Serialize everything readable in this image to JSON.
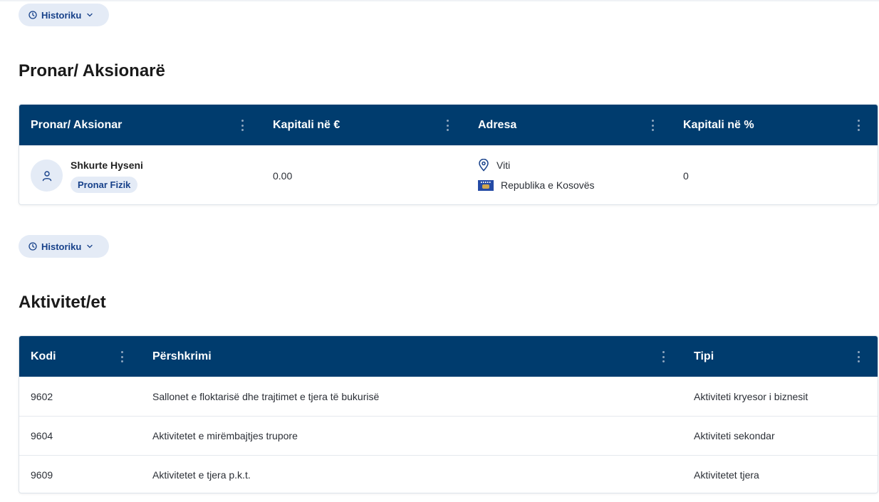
{
  "history_button": {
    "label": "Historiku"
  },
  "owners": {
    "title": "Pronar/ Aksionarë",
    "columns": [
      "Pronar/ Aksionar",
      "Kapitali në €",
      "Adresa",
      "Kapitali në %"
    ],
    "rows": [
      {
        "name": "Shkurte Hyseni",
        "type": "Pronar Fizik",
        "capital_eur": "0.00",
        "city": "Viti",
        "country": "Republika e Kosovës",
        "capital_pct": "0"
      }
    ]
  },
  "activities": {
    "title": "Aktivitet/et",
    "columns": [
      "Kodi",
      "Përshkrimi",
      "Tipi"
    ],
    "rows": [
      {
        "code": "9602",
        "description": "Sallonet e floktarisë dhe trajtimet e tjera të bukurisë",
        "type": "Aktiviteti kryesor i biznesit"
      },
      {
        "code": "9604",
        "description": "Aktivitetet e mirëmbajtjes trupore",
        "type": "Aktiviteti sekondar"
      },
      {
        "code": "9609",
        "description": "Aktivitetet e tjera p.k.t.",
        "type": "Aktivitetet tjera"
      }
    ]
  },
  "colors": {
    "header_bg": "#003c6e",
    "accent": "#17418a",
    "chip_bg": "#e4ebf6"
  },
  "icons": {
    "history": "clock-icon",
    "expand": "chevron-down-icon",
    "menu": "kebab-icon",
    "person": "user-icon",
    "location": "map-pin-icon",
    "flag": "kosovo-flag-icon"
  }
}
